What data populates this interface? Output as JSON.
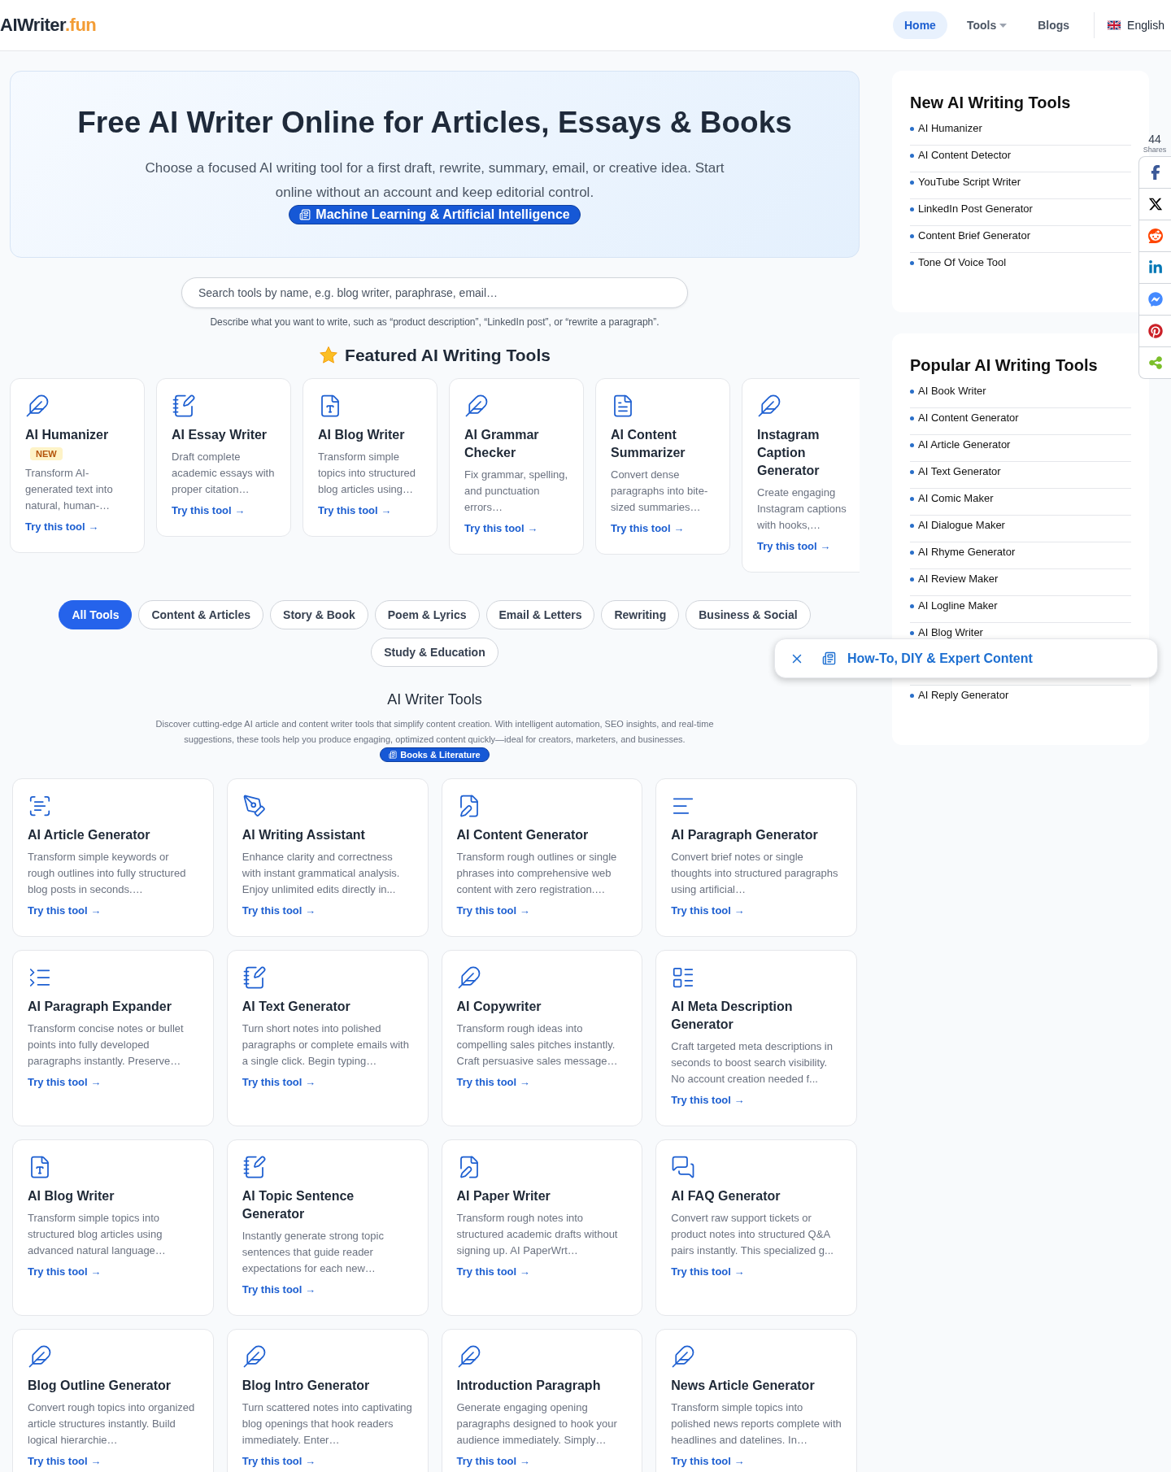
{
  "header": {
    "logo": {
      "main": "AIWriter",
      "accent": ".fun"
    },
    "nav": [
      {
        "label": "Home",
        "selected": true,
        "kind": "link"
      },
      {
        "label": "Tools",
        "selected": false,
        "kind": "dropdown"
      },
      {
        "label": "Blogs",
        "selected": false,
        "kind": "link"
      }
    ],
    "language": "English"
  },
  "hero": {
    "title": "Free AI Writer Online for Articles, Essays & Books",
    "subtitle": "Choose a focused AI writing tool for a first draft, rewrite, summary, email, or creative idea. Start online without an account and keep editorial control.",
    "tag": "Machine Learning & Artificial Intelligence"
  },
  "search": {
    "placeholder": "Search tools by name, e.g. blog writer, paraphrase, email…",
    "hint": "Describe what you want to write, such as “product description”, “LinkedIn post”, or “rewrite a paragraph”."
  },
  "featured": {
    "title": "Featured AI Writing Tools",
    "cards": [
      {
        "title": "AI Humanizer",
        "badge": "NEW",
        "description": "Transform AI-generated text into natural, human-…",
        "link": "Try this tool →"
      },
      {
        "title": "AI Essay Writer",
        "description": "Draft complete academic essays with proper citation…",
        "link": "Try this tool →"
      },
      {
        "title": "AI Blog Writer",
        "description": "Transform simple topics into structured blog articles using…",
        "link": "Try this tool →"
      },
      {
        "title": "AI Grammar Checker",
        "description": "Fix grammar, spelling, and punctuation errors…",
        "link": "Try this tool →"
      },
      {
        "title": "AI Content Summarizer",
        "description": "Convert dense paragraphs into bite-sized summaries…",
        "link": "Try this tool →"
      },
      {
        "title": "Instagram Caption Generator",
        "description": "Create engaging Instagram captions with hooks,…",
        "link": "Try this tool →"
      }
    ]
  },
  "filters": [
    {
      "label": "All Tools",
      "selected": true
    },
    {
      "label": "Content & Articles",
      "selected": false
    },
    {
      "label": "Story & Book",
      "selected": false
    },
    {
      "label": "Poem & Lyrics",
      "selected": false
    },
    {
      "label": "Email & Letters",
      "selected": false
    },
    {
      "label": "Rewriting",
      "selected": false
    },
    {
      "label": "Business & Social",
      "selected": false
    },
    {
      "label": "Study & Education",
      "selected": false
    }
  ],
  "tools_section": {
    "title": "AI Writer Tools",
    "description": "Discover cutting-edge AI article and content writer tools that simplify content creation. With intelligent automation, SEO insights, and real-time suggestions, these tools help you produce engaging, optimized content quickly—ideal for creators, marketers, and businesses.",
    "tag": "Books & Literature"
  },
  "tools": [
    {
      "title": "AI Article Generator",
      "description": "Transform simple keywords or rough outlines into fully structured blog posts in seconds.…",
      "link": "Try this tool →"
    },
    {
      "title": "AI Writing Assistant",
      "description": "Enhance clarity and correctness with instant grammatical analysis. Enjoy unlimited edits directly in...",
      "link": "Try this tool →"
    },
    {
      "title": "AI Content Generator",
      "description": "Transform rough outlines or single phrases into comprehensive web content with zero registration.…",
      "link": "Try this tool →"
    },
    {
      "title": "AI Paragraph Generator",
      "description": "Convert brief notes or single thoughts into structured paragraphs using artificial…",
      "link": "Try this tool →"
    },
    {
      "title": "AI Paragraph Expander",
      "description": "Transform concise notes or bullet points into fully developed paragraphs instantly. Preserve…",
      "link": "Try this tool →"
    },
    {
      "title": "AI Text Generator",
      "description": "Turn short notes into polished paragraphs or complete emails with a single click. Begin typing…",
      "link": "Try this tool →"
    },
    {
      "title": "AI Copywriter",
      "description": "Transform rough ideas into compelling sales pitches instantly. Craft persuasive sales message…",
      "link": "Try this tool →"
    },
    {
      "title": "AI Meta Description Generator",
      "description": "Craft targeted meta descriptions in seconds to boost search visibility. No account creation needed f...",
      "link": "Try this tool →"
    },
    {
      "title": "AI Blog Writer",
      "description": "Transform simple topics into structured blog articles using advanced natural language…",
      "link": "Try this tool →"
    },
    {
      "title": "AI Topic Sentence Generator",
      "description": "Instantly generate strong topic sentences that guide reader expectations for each new…",
      "link": "Try this tool →"
    },
    {
      "title": "AI Paper Writer",
      "description": "Transform rough notes into structured academic drafts without signing up. AI PaperWrt…",
      "link": "Try this tool →"
    },
    {
      "title": "AI FAQ Generator",
      "description": "Convert raw support tickets or product notes into structured Q&A pairs instantly. This specialized g...",
      "link": "Try this tool →"
    },
    {
      "title": "Blog Outline Generator",
      "description": "Convert rough topics into organized article structures instantly. Build logical hierarchie…",
      "link": "Try this tool →"
    },
    {
      "title": "Blog Intro Generator",
      "description": "Turn scattered notes into captivating blog openings that hook readers immediately. Enter…",
      "link": "Try this tool →"
    },
    {
      "title": "Introduction Paragraph",
      "description": "Generate engaging opening paragraphs designed to hook your audience immediately. Simply…",
      "link": "Try this tool →"
    },
    {
      "title": "News Article Generator",
      "description": "Transform simple topics into polished news reports complete with headlines and datelines. In…",
      "link": "Try this tool →"
    }
  ],
  "sidebar": {
    "new_tools": {
      "title": "New AI Writing Tools",
      "items": [
        "AI Humanizer",
        "AI Content Detector",
        "YouTube Script Writer",
        "LinkedIn Post Generator",
        "Content Brief Generator",
        "Tone Of Voice Tool"
      ]
    },
    "popular_tools": {
      "title": "Popular AI Writing Tools",
      "items_above": [
        "AI Book Writer",
        "AI Content Generator",
        "AI Article Generator",
        "AI Text Generator",
        "AI Comic Maker",
        "AI Dialogue Maker",
        "AI Rhyme Generator",
        "AI Review Maker",
        "AI Logline Maker",
        "AI Blog Writer"
      ],
      "items_below": [
        "AI Reply Generator"
      ]
    }
  },
  "toast": {
    "text": "How-To, DIY & Expert Content"
  },
  "share": {
    "count": "44",
    "label": "Shares",
    "buttons": [
      {
        "kind": "facebook",
        "color": "#3b5998"
      },
      {
        "kind": "x",
        "color": "#000000"
      },
      {
        "kind": "reddit",
        "color": "#ff4500"
      },
      {
        "kind": "linkedin",
        "color": "#0077b5"
      },
      {
        "kind": "messenger",
        "color": "#448aff"
      },
      {
        "kind": "pinterest",
        "color": "#cb2027"
      },
      {
        "kind": "share",
        "color": "#7bbf2a"
      }
    ]
  }
}
